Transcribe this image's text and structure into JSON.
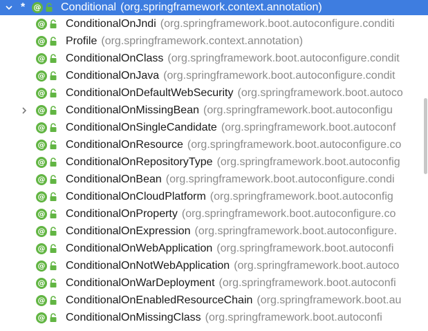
{
  "root": {
    "marker": "*",
    "name": "Conditional",
    "package": "(org.springframework.context.annotation)"
  },
  "children": [
    {
      "name": "ConditionalOnJndi",
      "package": "(org.springframework.boot.autoconfigure.conditi",
      "expandable": false
    },
    {
      "name": "Profile",
      "package": "(org.springframework.context.annotation)",
      "expandable": false
    },
    {
      "name": "ConditionalOnClass",
      "package": "(org.springframework.boot.autoconfigure.condit",
      "expandable": false
    },
    {
      "name": "ConditionalOnJava",
      "package": "(org.springframework.boot.autoconfigure.condit",
      "expandable": false
    },
    {
      "name": "ConditionalOnDefaultWebSecurity",
      "package": "(org.springframework.boot.autoco",
      "expandable": false
    },
    {
      "name": "ConditionalOnMissingBean",
      "package": "(org.springframework.boot.autoconfigu",
      "expandable": true
    },
    {
      "name": "ConditionalOnSingleCandidate",
      "package": "(org.springframework.boot.autoconf",
      "expandable": false
    },
    {
      "name": "ConditionalOnResource",
      "package": "(org.springframework.boot.autoconfigure.co",
      "expandable": false
    },
    {
      "name": "ConditionalOnRepositoryType",
      "package": "(org.springframework.boot.autoconfig",
      "expandable": false
    },
    {
      "name": "ConditionalOnBean",
      "package": "(org.springframework.boot.autoconfigure.condi",
      "expandable": false
    },
    {
      "name": "ConditionalOnCloudPlatform",
      "package": "(org.springframework.boot.autoconfig",
      "expandable": false
    },
    {
      "name": "ConditionalOnProperty",
      "package": "(org.springframework.boot.autoconfigure.co",
      "expandable": false
    },
    {
      "name": "ConditionalOnExpression",
      "package": "(org.springframework.boot.autoconfigure.",
      "expandable": false
    },
    {
      "name": "ConditionalOnWebApplication",
      "package": "(org.springframework.boot.autoconfi",
      "expandable": false
    },
    {
      "name": "ConditionalOnNotWebApplication",
      "package": "(org.springframework.boot.autoco",
      "expandable": false
    },
    {
      "name": "ConditionalOnWarDeployment",
      "package": "(org.springframework.boot.autoconfi",
      "expandable": false
    },
    {
      "name": "ConditionalOnEnabledResourceChain",
      "package": "(org.springframework.boot.au",
      "expandable": false
    },
    {
      "name": "ConditionalOnMissingClass",
      "package": "(org.springframework.boot.autoconfi",
      "expandable": false
    }
  ],
  "icons": {
    "root_arrow": "chevron-down-icon",
    "child_arrow": "chevron-right-icon",
    "annotation": "annotation-icon",
    "visibility": "public-lock-icon"
  },
  "colors": {
    "selection": "#3e7de0",
    "annotation_icon": "#62b543",
    "lock_icon": "#62b543",
    "name_text": "#1a1a1a",
    "package_text": "#8a8a8a"
  }
}
